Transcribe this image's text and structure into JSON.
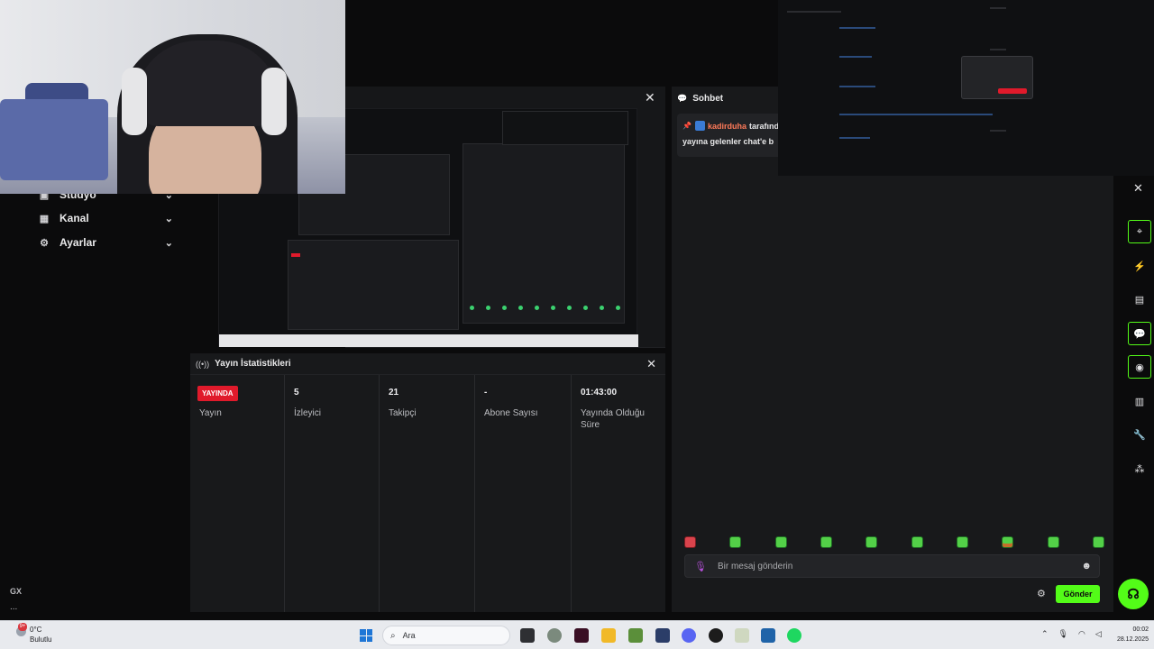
{
  "sidebar": {
    "items": [
      {
        "label": "Stüdyo",
        "icon": "studio-icon"
      },
      {
        "label": "Kanal",
        "icon": "channel-icon"
      },
      {
        "label": "Ayarlar",
        "icon": "gear-icon"
      }
    ],
    "footer_label": "GX",
    "more_label": "..."
  },
  "stats": {
    "title": "Yayın İstatistikleri",
    "status_badge": "YAYINDA",
    "columns": [
      {
        "value": "",
        "label": "Yayın"
      },
      {
        "value": "5",
        "label": "İzleyici"
      },
      {
        "value": "21",
        "label": "Takipçi"
      },
      {
        "value": "-",
        "label": "Abone Sayısı"
      },
      {
        "value": "01:43:00",
        "label": "Yayında Olduğu Süre"
      }
    ]
  },
  "chat": {
    "title": "Sohbet",
    "pinned": {
      "user": "kadirduha",
      "by_text": "tarafından",
      "message": "yayına gelenler chat'e b"
    },
    "input_placeholder": "Bir mesaj gönderin",
    "send_label": "Gönder"
  },
  "taskbar": {
    "weather_temp": "0°C",
    "weather_desc": "Bulutlu",
    "notification_count": "9+",
    "search_label": "Ara",
    "time": "00:02",
    "date": "28.12.2025"
  },
  "colors": {
    "accent": "#53fc18",
    "live": "#e01a2b",
    "panel": "#18191b",
    "background": "#0b0b0c"
  }
}
